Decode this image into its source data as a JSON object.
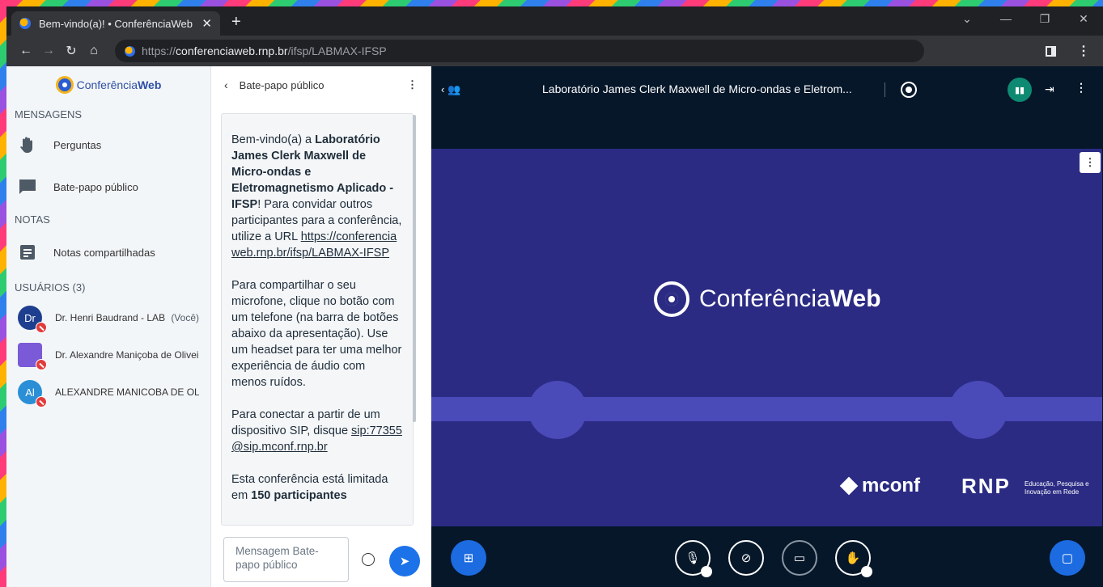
{
  "browser": {
    "tab_title": "Bem-vindo(a)! • ConferênciaWeb",
    "tab_close": "✕",
    "new_tab": "+",
    "url_prefix": "https://",
    "url_host": "conferenciaweb.rnp.br",
    "url_path": "/ifsp/LABMAX-IFSP",
    "window_controls": [
      "⌄",
      "—",
      "❐",
      "✕"
    ]
  },
  "sidebar": {
    "brand_prefix": "Conferência",
    "brand_suffix": "Web",
    "messages_heading": "MENSAGENS",
    "items": [
      {
        "label": "Perguntas",
        "icon": "raised-hand-icon"
      },
      {
        "label": "Bate-papo público",
        "icon": "chat-icon"
      }
    ],
    "notes_heading": "NOTAS",
    "notes_item": "Notas compartilhadas",
    "users_heading": "USUÁRIOS",
    "users_count": "(3)",
    "users": [
      {
        "initials": "Dr",
        "name": "Dr. Henri Baudrand - LAB...",
        "you": "(Você)",
        "color": "#1e3f8f"
      },
      {
        "initials": "",
        "name": "Dr. Alexandre Maniçoba de Olivei...",
        "you": "",
        "color": "#7a5ad6"
      },
      {
        "initials": "Al",
        "name": "ALEXANDRE MANICOBA DE OLI...",
        "you": "",
        "color": "#2a8fd6"
      }
    ]
  },
  "chat": {
    "title": "Bate-papo público",
    "welcome_1": "Bem-vindo(a) a ",
    "welcome_bold": "Laboratório James Clerk Maxwell de Micro-ondas e Eletromagnetismo Aplicado - IFSP",
    "welcome_2": "! Para convidar outros participantes para a conferência, utilize a URL ",
    "url": "https://conferenciaweb.rnp.br/ifsp/LABMAX-IFSP",
    "mic_text": "Para compartilhar o seu microfone, clique no botão com um telefone (na barra de botões abaixo da apresentação). Use um headset para ter uma melhor experiência de áudio com menos ruídos.",
    "sip_text": "Para conectar a partir de um dispositivo SIP, disque ",
    "sip_address": "sip:77355@sip.mconf.rnp.br",
    "limit_1": "Esta conferência está limitada em ",
    "limit_bold": "150 participantes",
    "input_placeholder": "Mensagem Bate-papo público"
  },
  "meeting": {
    "title": "Laboratório James Clerk Maxwell de Micro-ondas e Eletrom...",
    "presentation_logo_prefix": "Conferência",
    "presentation_logo_suffix": "Web",
    "mconf": "mconf",
    "rnp": "RNP",
    "rnp_tagline": "Educação, Pesquisa e Inovação em Rede"
  },
  "colors": {
    "accent": "#1c6be0",
    "presentation_bg": "#2b2b84",
    "main_bg": "#06172a",
    "mute_badge": "#e23b3b",
    "connection": "#0f8a72"
  }
}
